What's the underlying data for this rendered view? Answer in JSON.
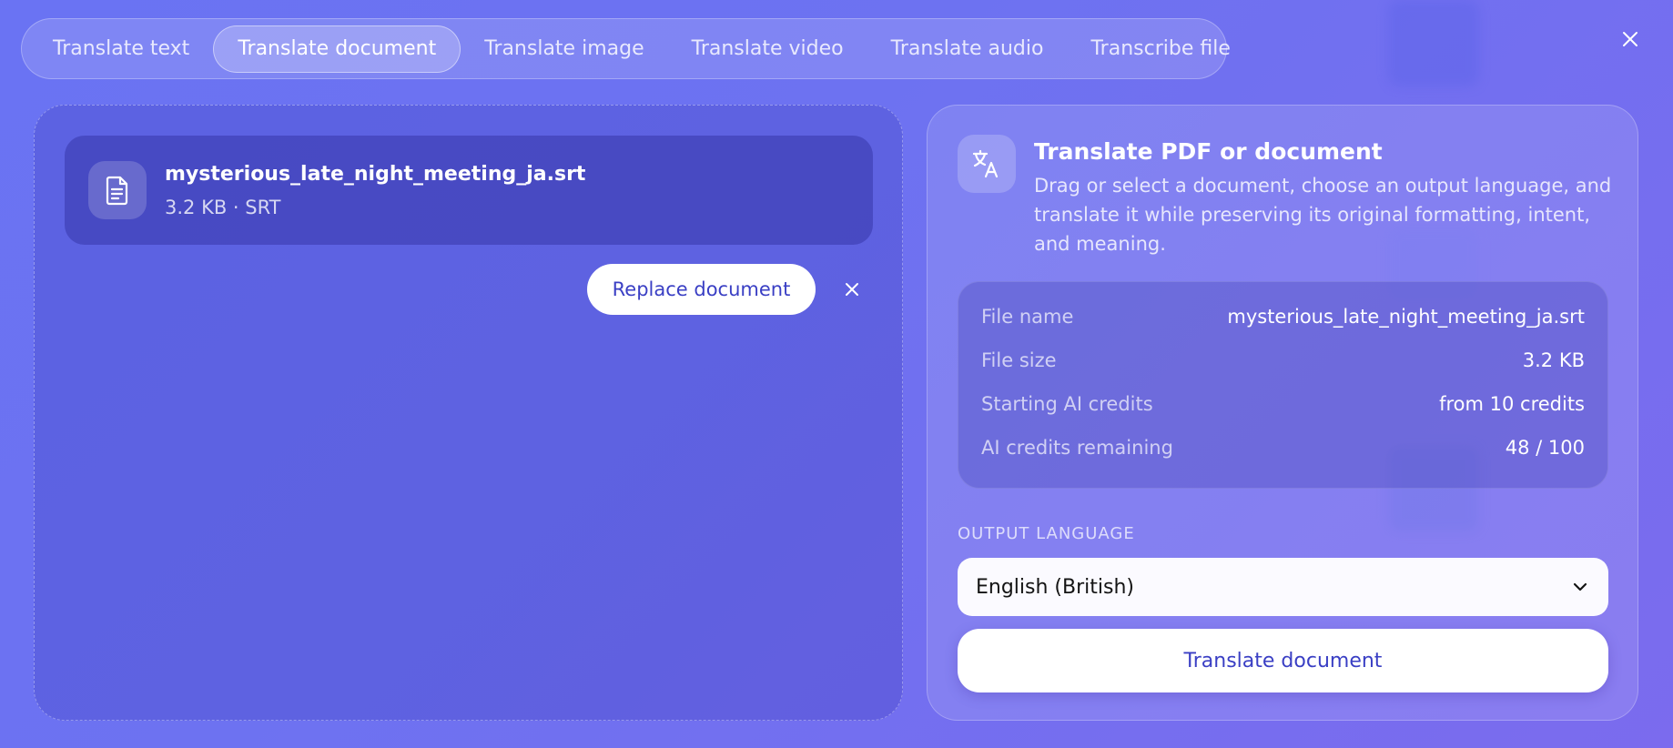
{
  "tabs": [
    {
      "label": "Translate text",
      "active": false
    },
    {
      "label": "Translate document",
      "active": true
    },
    {
      "label": "Translate image",
      "active": false
    },
    {
      "label": "Translate video",
      "active": false
    },
    {
      "label": "Translate audio",
      "active": false
    },
    {
      "label": "Transcribe file",
      "active": false
    }
  ],
  "file": {
    "name": "mysterious_late_night_meeting_ja.srt",
    "meta": "3.2 KB · SRT",
    "icon": "document-icon"
  },
  "dropzone": {
    "replace_label": "Replace document"
  },
  "panel": {
    "icon": "translate-icon",
    "title": "Translate PDF or document",
    "description": "Drag or select a document, choose an output language, and translate it while preserving its original formatting, intent, and meaning.",
    "info": [
      {
        "label": "File name",
        "value": "mysterious_late_night_meeting_ja.srt"
      },
      {
        "label": "File size",
        "value": "3.2 KB"
      },
      {
        "label": "Starting AI credits",
        "value": "from 10 credits"
      },
      {
        "label": "AI credits remaining",
        "value": "48 / 100"
      }
    ],
    "output_language_label": "OUTPUT LANGUAGE",
    "output_language_value": "English (British)",
    "translate_label": "Translate document"
  },
  "colors": {
    "accent": "#3a3fc4",
    "background_start": "#6a73f3",
    "background_end": "#7b6bee"
  }
}
